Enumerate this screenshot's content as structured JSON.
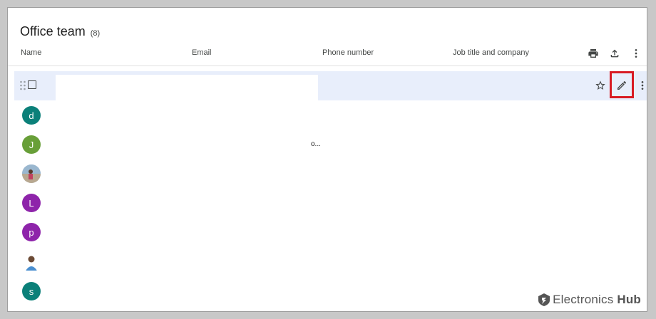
{
  "list": {
    "title": "Office team",
    "count": "(8)"
  },
  "columns": [
    "Name",
    "Email",
    "Phone number",
    "Job title and company"
  ],
  "header_actions": [
    "print-icon",
    "export-icon",
    "more-vert-icon"
  ],
  "selected_row": {
    "actions": [
      "star-icon",
      "edit-icon",
      "more-vert-icon"
    ],
    "highlighted_action": "edit-icon",
    "highlight_color": "#d81b24"
  },
  "contacts": [
    {
      "initial": "d",
      "color": "#0b8079"
    },
    {
      "initial": "J",
      "color": "#689f38"
    },
    {
      "initial": "",
      "photo": true
    },
    {
      "initial": "L",
      "color": "#8e24aa"
    },
    {
      "initial": "p",
      "color": "#8e24aa"
    },
    {
      "initial": "",
      "photo": true
    },
    {
      "initial": "s",
      "color": "#0b8079"
    }
  ],
  "truncated_text": "o...",
  "watermark": {
    "part1": "Electronics",
    "part2": "Hub"
  }
}
